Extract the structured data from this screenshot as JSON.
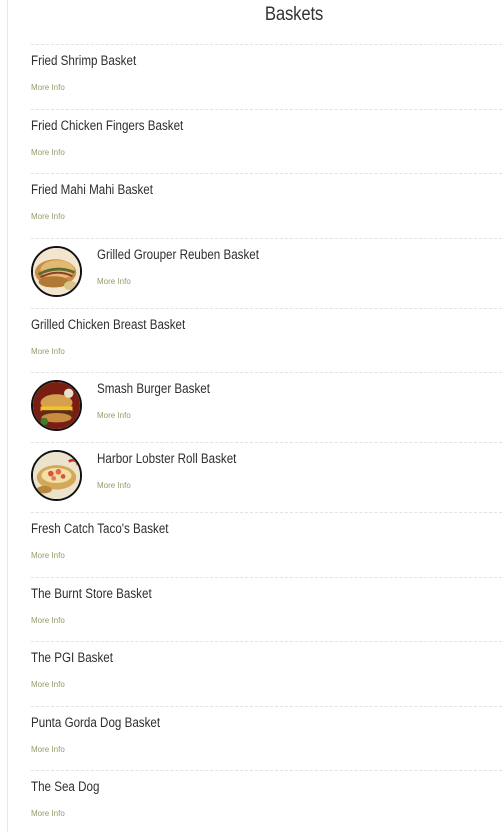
{
  "page": {
    "title": "Baskets"
  },
  "items": [
    {
      "name": "Fried Shrimp Basket",
      "more": "More Info",
      "has_photo": false
    },
    {
      "name": "Fried Chicken Fingers Basket",
      "more": "More Info",
      "has_photo": false
    },
    {
      "name": "Fried Mahi Mahi Basket",
      "more": "More Info",
      "has_photo": false
    },
    {
      "name": "Grilled Grouper Reuben Basket",
      "more": "More Info",
      "has_photo": true,
      "photo": "reuben-sandwich-photo"
    },
    {
      "name": "Grilled Chicken Breast Basket",
      "more": "More Info",
      "has_photo": false
    },
    {
      "name": "Smash Burger Basket",
      "more": "More Info",
      "has_photo": true,
      "photo": "burger-photo"
    },
    {
      "name": "Harbor Lobster Roll Basket",
      "more": "More Info",
      "has_photo": true,
      "photo": "lobster-roll-photo"
    },
    {
      "name": "Fresh Catch Taco's Basket",
      "more": "More Info",
      "has_photo": false
    },
    {
      "name": "The Burnt Store Basket",
      "more": "More Info",
      "has_photo": false
    },
    {
      "name": "The PGI Basket",
      "more": "More Info",
      "has_photo": false
    },
    {
      "name": "Punta Gorda Dog Basket",
      "more": "More Info",
      "has_photo": false
    },
    {
      "name": "The Sea Dog",
      "more": "More Info",
      "has_photo": false
    }
  ],
  "colors": {
    "title": "#333333",
    "item_name": "#2e2e2e",
    "more_info": "#8f9e69",
    "divider": "#e2e2e2"
  }
}
